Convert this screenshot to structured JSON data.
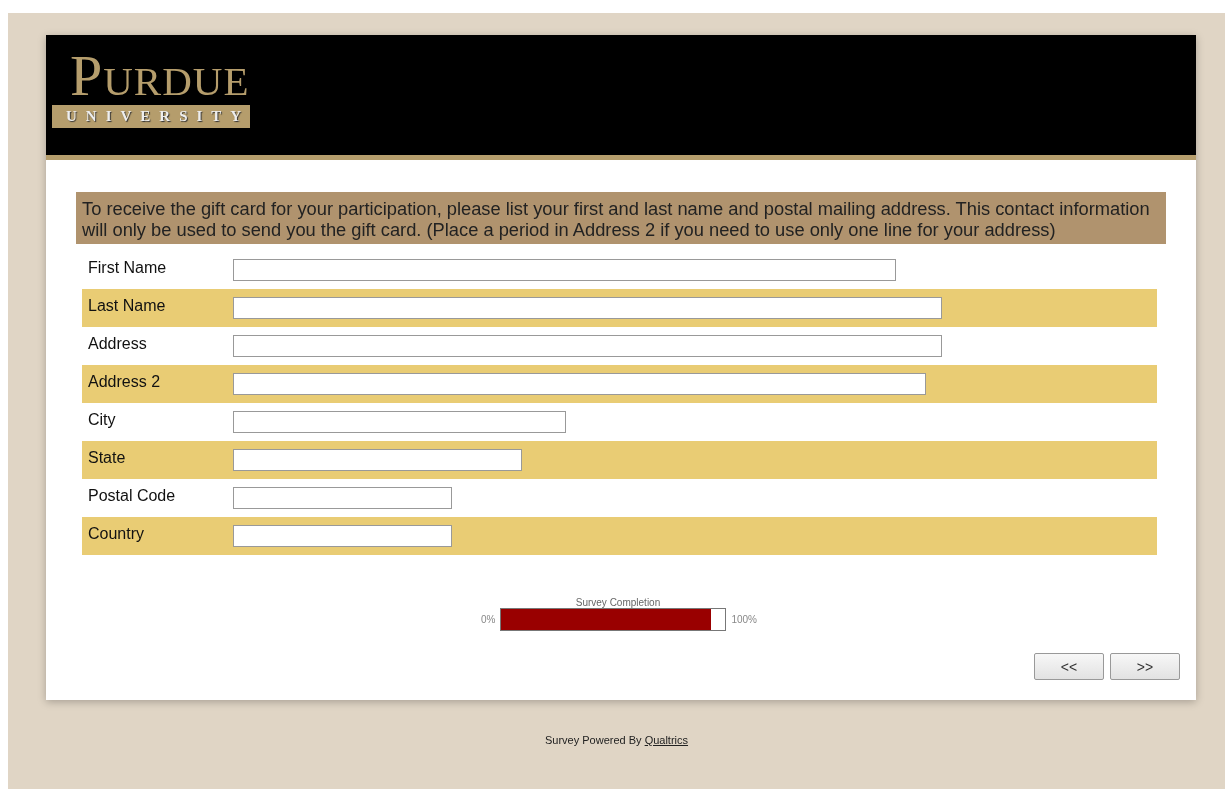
{
  "header": {
    "logo_title": "Purdue",
    "logo_subtitle": "UNIVERSITY"
  },
  "question": {
    "text": "To receive the gift card for your participation, please list your first and last name and postal mailing address. This contact information will only be used to send you the gift card. (Place a period in Address 2 if you need to use only one line for your address)"
  },
  "fields": [
    {
      "label": "First Name"
    },
    {
      "label": "Last Name"
    },
    {
      "label": "Address"
    },
    {
      "label": "Address 2"
    },
    {
      "label": "City"
    },
    {
      "label": "State"
    },
    {
      "label": "Postal Code"
    },
    {
      "label": "Country"
    }
  ],
  "progress": {
    "title": "Survey Completion",
    "min_label": "0%",
    "max_label": "100%",
    "level": 0.935
  },
  "buttons": [
    "<<",
    ">>"
  ],
  "footer": {
    "text": "Survey Powered By",
    "link": "Qualtrics"
  }
}
